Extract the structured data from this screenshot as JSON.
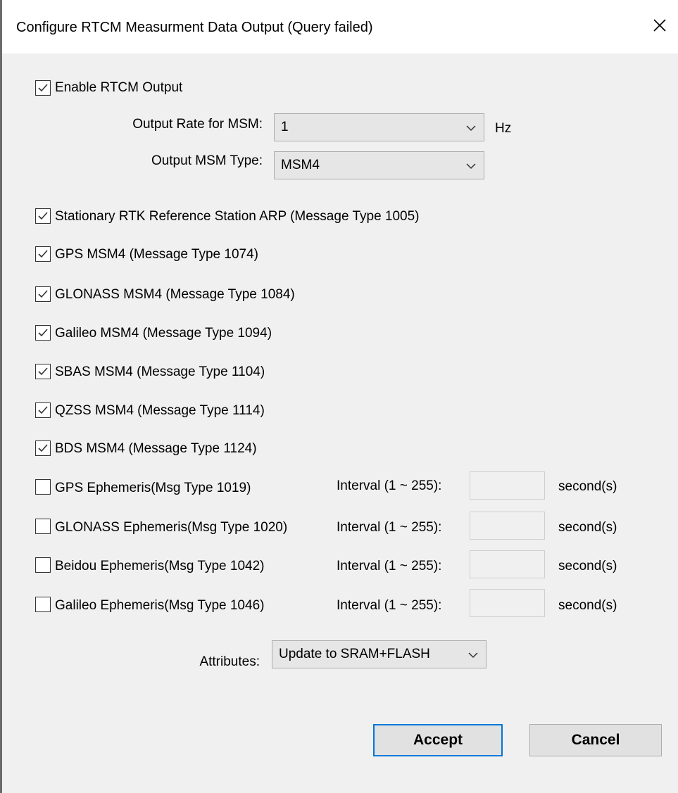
{
  "dialog": {
    "title": "Configure RTCM Measurment Data Output (Query failed)"
  },
  "enable_output": {
    "label": "Enable RTCM Output",
    "checked": true
  },
  "output_rate": {
    "label": "Output Rate for MSM:",
    "value": "1",
    "unit": "Hz"
  },
  "msm_type": {
    "label": "Output MSM Type:",
    "value": "MSM4"
  },
  "messages": [
    {
      "label": "Stationary RTK Reference Station ARP (Message Type 1005)",
      "checked": true
    },
    {
      "label": "GPS MSM4 (Message Type 1074)",
      "checked": true
    },
    {
      "label": "GLONASS MSM4 (Message Type 1084)",
      "checked": true
    },
    {
      "label": "Galileo MSM4 (Message Type 1094)",
      "checked": true
    },
    {
      "label": "SBAS MSM4 (Message Type 1104)",
      "checked": true
    },
    {
      "label": "QZSS MSM4 (Message Type 1114)",
      "checked": true
    },
    {
      "label": "BDS MSM4 (Message Type 1124)",
      "checked": true
    }
  ],
  "ephemeris": [
    {
      "label": "GPS Ephemeris(Msg Type 1019)",
      "checked": false,
      "interval_label": "Interval (1 ~ 255):",
      "interval_value": "",
      "unit": "second(s)"
    },
    {
      "label": "GLONASS Ephemeris(Msg Type 1020)",
      "checked": false,
      "interval_label": "Interval (1 ~ 255):",
      "interval_value": "",
      "unit": "second(s)"
    },
    {
      "label": "Beidou Ephemeris(Msg Type 1042)",
      "checked": false,
      "interval_label": "Interval (1 ~ 255):",
      "interval_value": "",
      "unit": "second(s)"
    },
    {
      "label": "Galileo Ephemeris(Msg Type 1046)",
      "checked": false,
      "interval_label": "Interval (1 ~ 255):",
      "interval_value": "",
      "unit": "second(s)"
    }
  ],
  "attributes": {
    "label": "Attributes:",
    "value": "Update to SRAM+FLASH"
  },
  "buttons": {
    "accept": "Accept",
    "cancel": "Cancel"
  },
  "colors": {
    "accent": "#0078d7",
    "background": "#f0f0f0",
    "titlebar": "#ffffff"
  }
}
